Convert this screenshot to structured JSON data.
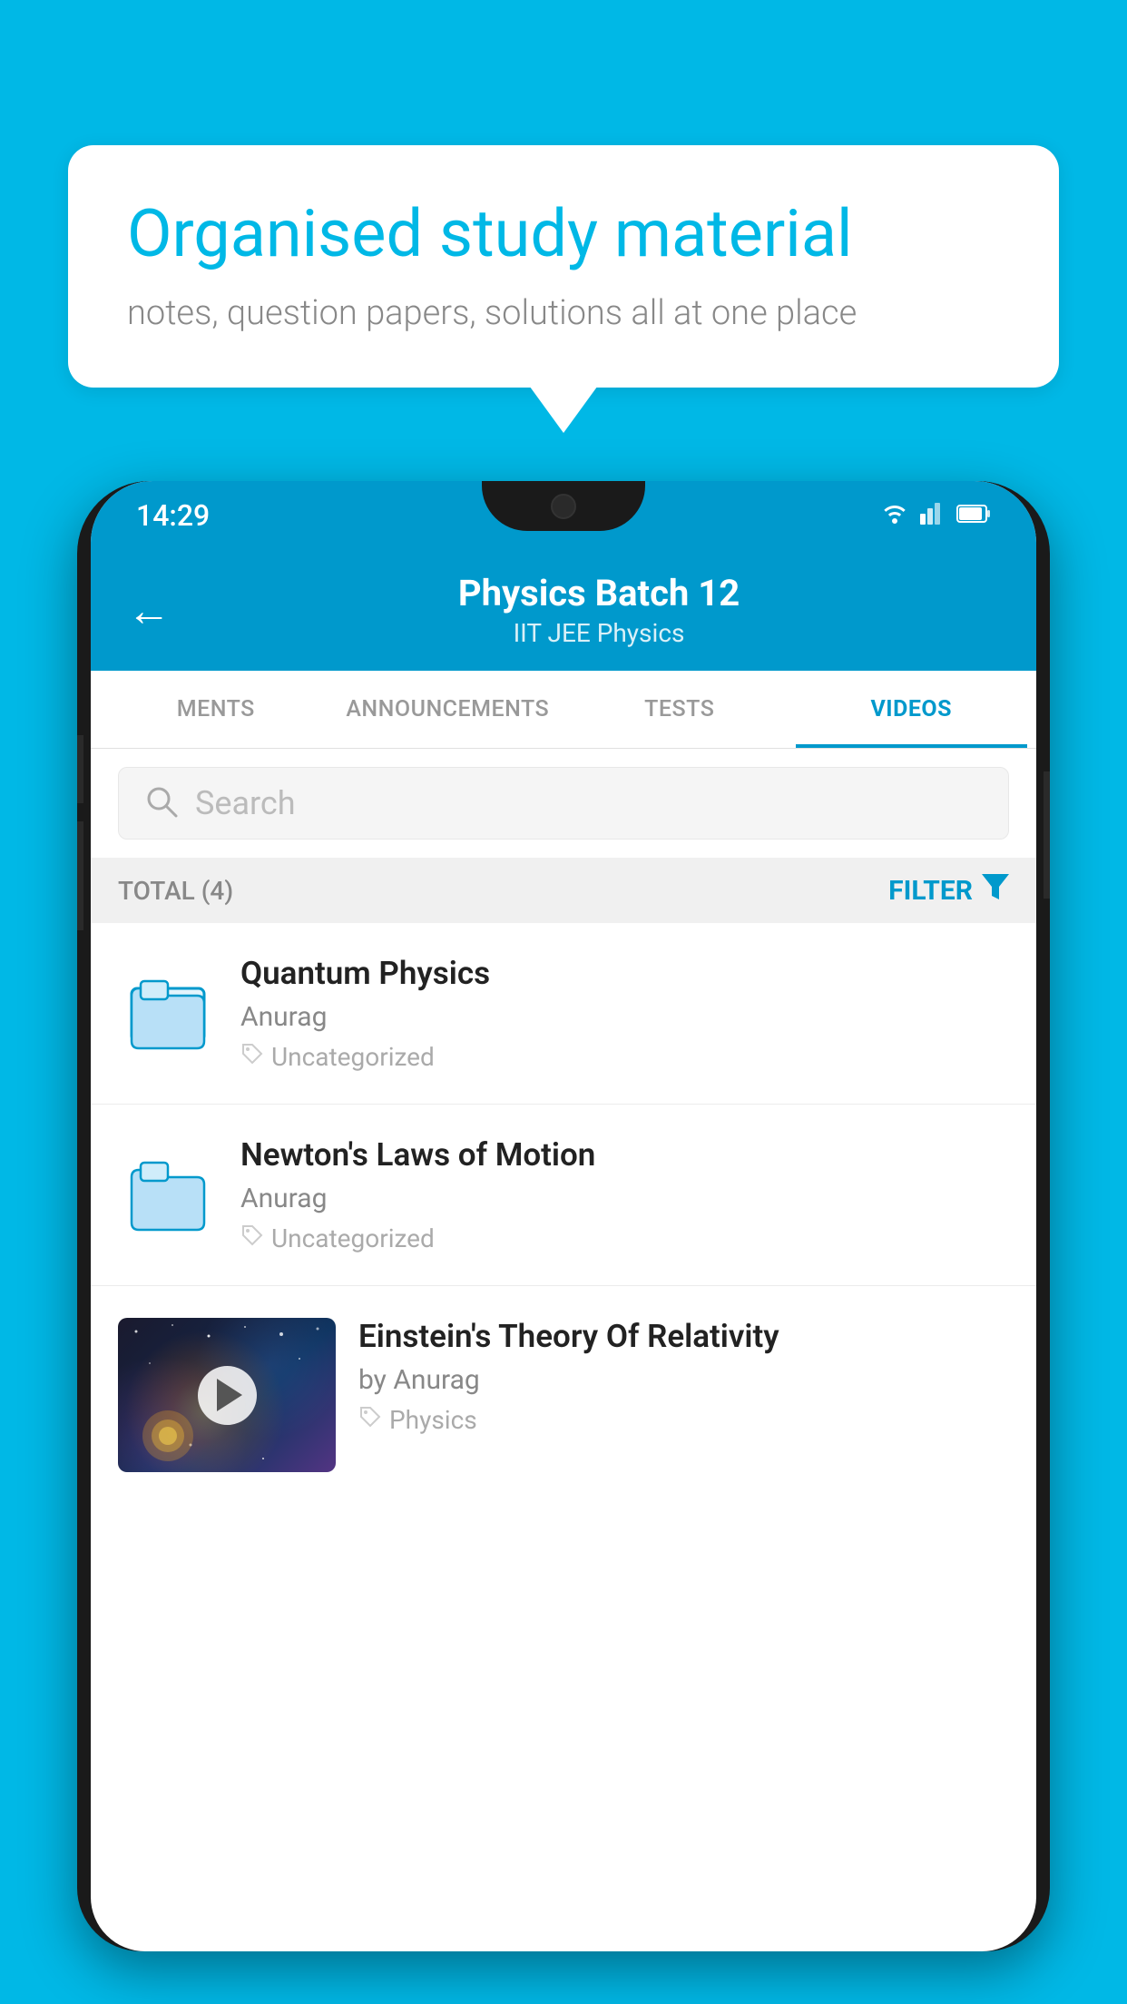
{
  "background": {
    "color": "#00b8e6"
  },
  "speech_bubble": {
    "title": "Organised study material",
    "subtitle": "notes, question papers, solutions all at one place"
  },
  "status_bar": {
    "time": "14:29",
    "wifi_icon": "wifi",
    "signal_icon": "signal",
    "battery_icon": "battery"
  },
  "app_header": {
    "back_label": "←",
    "title": "Physics Batch 12",
    "subtitle": "IIT JEE   Physics"
  },
  "tabs": [
    {
      "id": "ments",
      "label": "MENTS",
      "active": false
    },
    {
      "id": "announcements",
      "label": "ANNOUNCEMENTS",
      "active": false
    },
    {
      "id": "tests",
      "label": "TESTS",
      "active": false
    },
    {
      "id": "videos",
      "label": "VIDEOS",
      "active": true
    }
  ],
  "search": {
    "placeholder": "Search"
  },
  "filter_bar": {
    "total_label": "TOTAL (4)",
    "filter_label": "FILTER"
  },
  "videos": [
    {
      "id": "v1",
      "title": "Quantum Physics",
      "author": "Anurag",
      "tag": "Uncategorized",
      "type": "folder",
      "has_thumb": false
    },
    {
      "id": "v2",
      "title": "Newton's Laws of Motion",
      "author": "Anurag",
      "tag": "Uncategorized",
      "type": "folder",
      "has_thumb": false
    },
    {
      "id": "v3",
      "title": "Einstein's Theory Of Relativity",
      "author": "by Anurag",
      "tag": "Physics",
      "type": "video",
      "has_thumb": true
    }
  ]
}
